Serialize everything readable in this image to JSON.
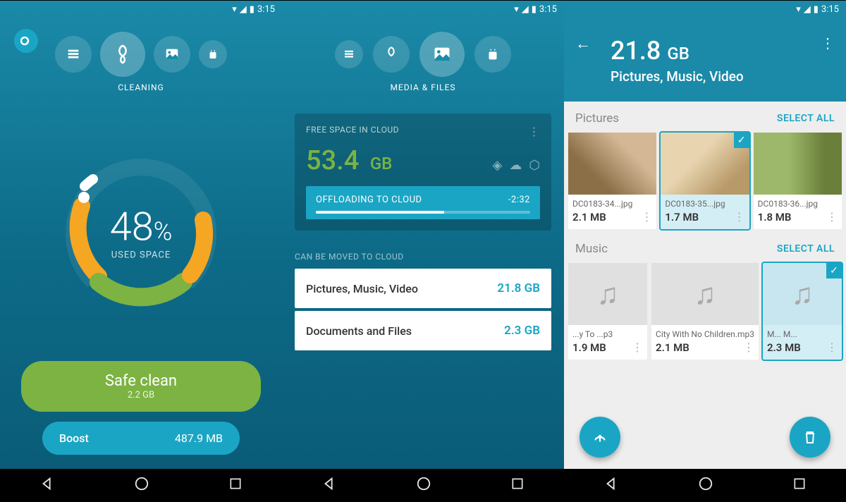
{
  "status": {
    "time": "3:15"
  },
  "screen1": {
    "nav_label": "CLEANING",
    "gauge": {
      "percent": "48",
      "percent_sign": "%",
      "label": "USED SPACE"
    },
    "safe_clean": {
      "title": "Safe clean",
      "sub": "2.2 GB"
    },
    "boost": {
      "title": "Boost",
      "size": "487.9 MB"
    }
  },
  "screen2": {
    "nav_label": "MEDIA & FILES",
    "cloud": {
      "header": "FREE SPACE IN CLOUD",
      "size": "53.4",
      "unit": "GB",
      "offload_label": "OFFLOADING TO CLOUD",
      "offload_eta": "-2:32"
    },
    "move_label": "CAN BE MOVED TO CLOUD",
    "rows": [
      {
        "label": "Pictures, Music, Video",
        "size": "21.8 GB"
      },
      {
        "label": "Documents and Files",
        "size": "2.3 GB"
      }
    ]
  },
  "screen3": {
    "title_num": "21.8",
    "title_unit": "GB",
    "subtitle": "Pictures, Music, Video",
    "groups": {
      "pictures": {
        "name": "Pictures",
        "select_all": "SELECT ALL"
      },
      "music": {
        "name": "Music",
        "select_all": "SELECT ALL"
      }
    },
    "pics": [
      {
        "name": "DC0183-34...jpg",
        "size": "2.1 MB"
      },
      {
        "name": "DC0183-35...jpg",
        "size": "1.7 MB"
      },
      {
        "name": "DC0183-36...jpg",
        "size": "1.8 MB"
      }
    ],
    "music": [
      {
        "name": "...y To ...p3",
        "size": "1.9 MB"
      },
      {
        "name": "City With No Children.mp3",
        "size": "2.1 MB"
      },
      {
        "name": "M... M...",
        "size": "2.3 MB"
      }
    ]
  }
}
